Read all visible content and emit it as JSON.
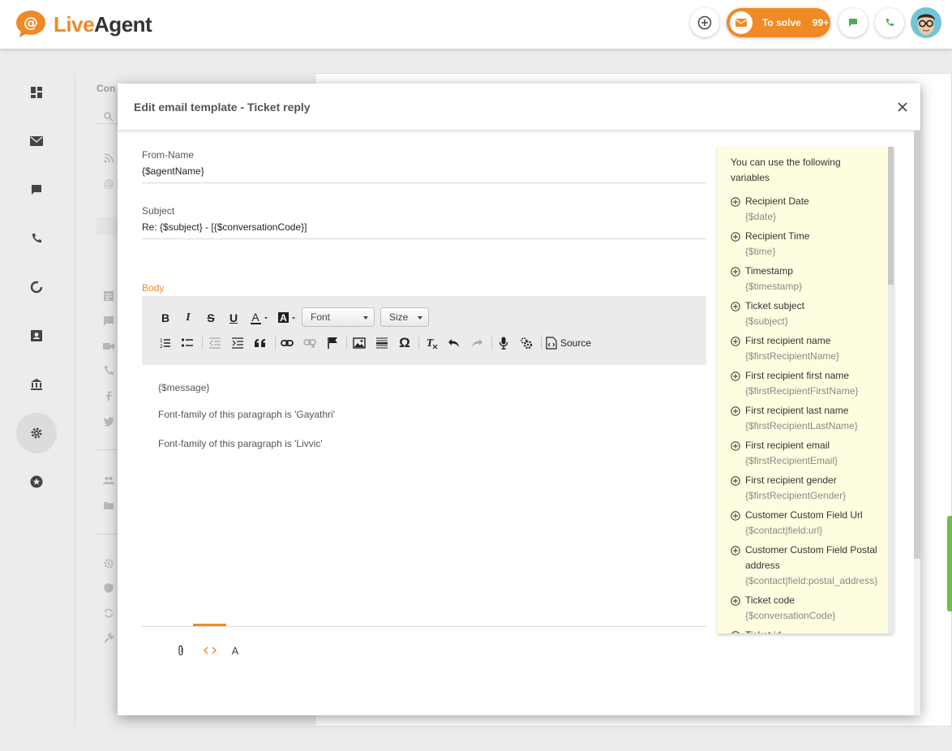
{
  "app": {
    "brand": {
      "live": "Live",
      "agent": "Agent"
    },
    "colors": {
      "accent": "#f08a24",
      "chat": "#4caf50",
      "call": "#4caf50"
    },
    "header": {
      "solve_label": "To solve",
      "solve_count": "99+",
      "icons": [
        "add-icon",
        "mail-icon",
        "chat-icon",
        "phone-icon",
        "avatar"
      ]
    },
    "sidebar": {
      "icons": [
        "dashboard-icon",
        "mail-icon",
        "chat-icon",
        "phone-icon",
        "reports-icon",
        "contacts-icon",
        "company-icon",
        "settings-icon",
        "star-icon"
      ],
      "active": "settings-icon",
      "subpanel_partial_text": "Con"
    }
  },
  "modal": {
    "title": "Edit email template - Ticket reply",
    "from_name": {
      "label": "From-Name",
      "value": "{$agentName}"
    },
    "subject": {
      "label": "Subject",
      "value": "Re: {$subject} - [{$conversationCode}]"
    },
    "body": {
      "label": "Body",
      "toolbar": {
        "font_label": "Font",
        "size_label": "Size",
        "source_label": "Source",
        "buttons": [
          "bold",
          "italic",
          "strikethrough",
          "underline",
          "text-color",
          "background-color",
          "numbered-list",
          "bulleted-list",
          "outdent",
          "indent",
          "blockquote",
          "link",
          "unlink",
          "anchor",
          "image",
          "horizontal-line",
          "special-char",
          "remove-format",
          "undo",
          "redo",
          "microphone",
          "settings",
          "source"
        ]
      },
      "paragraphs": [
        "{$message}",
        "Font-family of this paragraph is 'Gayathri'",
        "Font-family of this paragraph is 'Livvic'"
      ],
      "bottom_tabs": [
        "attachment-icon",
        "code-icon",
        "A"
      ]
    },
    "variables": {
      "heading": "You can use the following variables",
      "items": [
        {
          "name": "Recipient Date",
          "code": "{$date}"
        },
        {
          "name": "Recipient Time",
          "code": "{$time}"
        },
        {
          "name": "Timestamp",
          "code": "{$timestamp}"
        },
        {
          "name": "Ticket subject",
          "code": "{$subject}"
        },
        {
          "name": "First recipient name",
          "code": "{$firstRecipientName}"
        },
        {
          "name": "First recipient first name",
          "code": "{$firstRecipientFirstName}"
        },
        {
          "name": "First recipient last name",
          "code": "{$firstRecipientLastName}"
        },
        {
          "name": "First recipient email",
          "code": "{$firstRecipientEmail}"
        },
        {
          "name": "First recipient gender",
          "code": "{$firstRecipientGender}"
        },
        {
          "name": "Customer Custom Field Url",
          "code": "{$contact|field:url}"
        },
        {
          "name": "Customer Custom Field Postal address",
          "code": "{$contact|field:postal_address}"
        },
        {
          "name": "Ticket code",
          "code": "{$conversationCode}"
        },
        {
          "name": "Ticket id",
          "code": ""
        }
      ]
    }
  }
}
